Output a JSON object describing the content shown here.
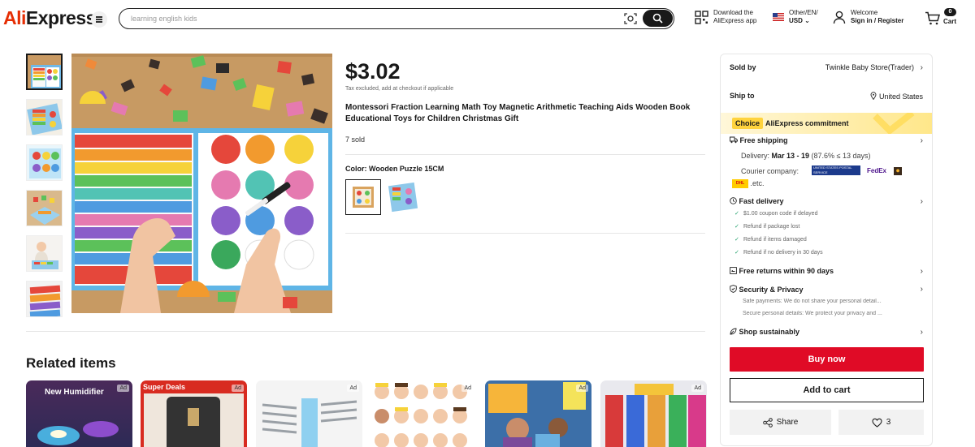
{
  "header": {
    "logo_prefix": "Ali",
    "logo_suffix": "Express",
    "search_placeholder": "learning english kids",
    "download_line1": "Download the",
    "download_line2": "AliExpress app",
    "region_line1": "Other/EN/",
    "region_line2": "USD",
    "welcome_line1": "Welcome",
    "welcome_line2": "Sign in / Register",
    "cart_count": "0",
    "cart_label": "Cart"
  },
  "product": {
    "price": "$3.02",
    "tax_note": "Tax excluded, add at checkout if applicable",
    "title": "Montessori Fraction Learning Math Toy Magnetic Arithmetic Teaching Aids Wooden Book Educational Toys for Children Christmas Gift",
    "sold": "7 sold",
    "color_label": "Color: Wooden Puzzle 15CM"
  },
  "related": {
    "title": "Related items",
    "items": [
      {
        "caption": "New Humidifier",
        "ad": "Ad"
      },
      {
        "caption": "Super Deals",
        "ad": "Ad"
      },
      {
        "caption": "",
        "ad": "Ad"
      },
      {
        "caption": "",
        "ad": "Ad"
      },
      {
        "caption": "",
        "ad": "Ad"
      },
      {
        "caption": "",
        "ad": "Ad"
      }
    ]
  },
  "panel": {
    "sold_by_label": "Sold by",
    "store_name": "Twinkle Baby Store(Trader)",
    "ship_to_label": "Ship to",
    "ship_to_value": "United States",
    "choice_tag": "Choice",
    "choice_text": "AliExpress commitment",
    "free_shipping": "Free shipping",
    "delivery_prefix": "Delivery: ",
    "delivery_dates": "Mar 13 - 19",
    "delivery_suffix": " (87.6% ≤ 13 days)",
    "courier_label": "Courier company:",
    "courier_usps": "UNITED STATES POSTAL SERVICE",
    "courier_fedex": "FedEx",
    "courier_dhl": "DHL",
    "courier_etc": ".etc.",
    "fast_delivery": "Fast delivery",
    "fast_items": [
      "$1.00 coupon code if delayed",
      "Refund if package lost",
      "Refund if items damaged",
      "Refund if no delivery in 30 days"
    ],
    "free_returns": "Free returns within 90 days",
    "security": "Security & Privacy",
    "security_1": "Safe payments: We do not share your personal detail...",
    "security_2": "Secure personal details: We protect your privacy and ...",
    "sustain": "Shop sustainably",
    "buy_now": "Buy now",
    "add_to_cart": "Add to cart",
    "share": "Share",
    "wishlist_count": "3"
  }
}
